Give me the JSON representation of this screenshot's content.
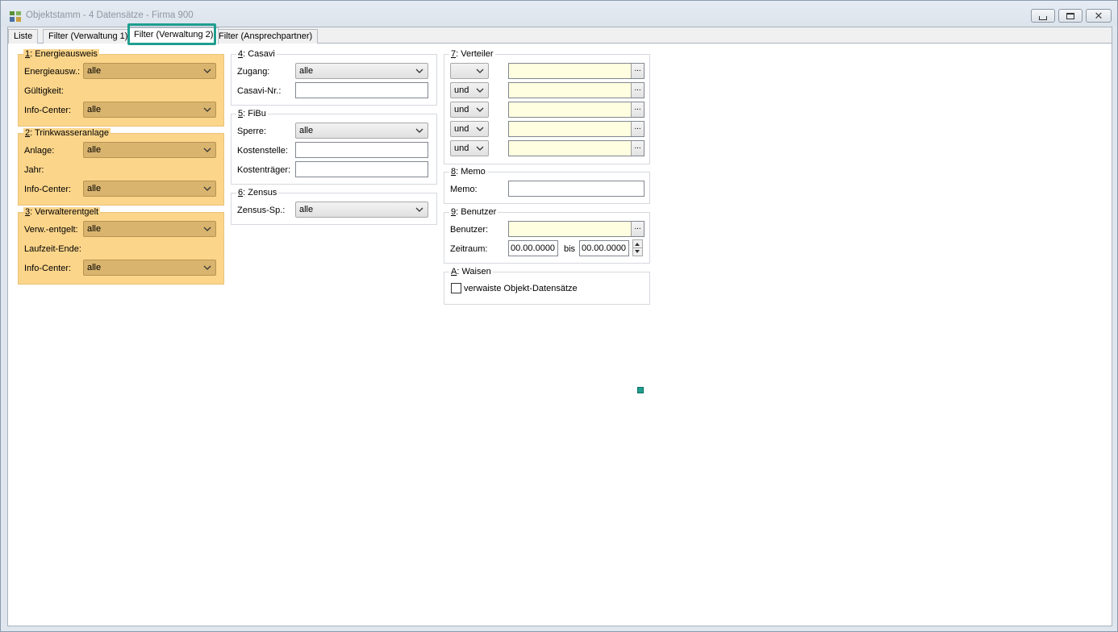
{
  "window": {
    "title": "Objektstamm - 4 Datensätze - Firma 900",
    "buttons": [
      "minimize",
      "maximize",
      "close"
    ],
    "close_glyph": "✕"
  },
  "tabs": [
    {
      "label": "Liste"
    },
    {
      "label": "Filter (Verwaltung 1)"
    },
    {
      "label": "Filter (Verwaltung 2)",
      "active": true
    },
    {
      "label": "Filter (Ansprechpartner)"
    }
  ],
  "colors": {
    "highlight_group": "#fbd58a",
    "tab_highlight": "#1f9e8f",
    "lookup_field": "#fffee0"
  },
  "g1": {
    "num": "1",
    "title": ": Energieausweis",
    "energie_label": "Energieausw.:",
    "energie_value": "alle",
    "gueltigkeit_label": "Gültigkeit:",
    "info_label": "Info-Center:",
    "info_value": "alle"
  },
  "g2": {
    "num": "2",
    "title": ": Trinkwasseranlage",
    "anlage_label": "Anlage:",
    "anlage_value": "alle",
    "jahr_label": "Jahr:",
    "info_label": "Info-Center:",
    "info_value": "alle"
  },
  "g3": {
    "num": "3",
    "title": ": Verwalterentgelt",
    "verw_label": "Verw.-entgelt:",
    "verw_value": "alle",
    "laufzeit_label": "Laufzeit-Ende:",
    "info_label": "Info-Center:",
    "info_value": "alle"
  },
  "g4": {
    "num": "4",
    "title": ": Casavi",
    "zugang_label": "Zugang:",
    "zugang_value": "alle",
    "nr_label": "Casavi-Nr.:",
    "nr_value": ""
  },
  "g5": {
    "num": "5",
    "title": ": FiBu",
    "sperre_label": "Sperre:",
    "sperre_value": "alle",
    "kostenstelle_label": "Kostenstelle:",
    "kostenstelle_value": "",
    "kostentraeger_label": "Kostenträger:",
    "kostentraeger_value": ""
  },
  "g6": {
    "num": "6",
    "title": ": Zensus",
    "zensus_label": "Zensus-Sp.:",
    "zensus_value": "alle"
  },
  "g7": {
    "num": "7",
    "title": ": Verteiler",
    "rows": [
      {
        "op": "",
        "value": ""
      },
      {
        "op": "und",
        "value": ""
      },
      {
        "op": "und",
        "value": ""
      },
      {
        "op": "und",
        "value": ""
      },
      {
        "op": "und",
        "value": ""
      }
    ],
    "dots": "..."
  },
  "g8": {
    "num": "8",
    "title": ": Memo",
    "memo_label": "Memo:",
    "memo_value": ""
  },
  "g9": {
    "num": "9",
    "title": ": Benutzer",
    "benutzer_label": "Benutzer:",
    "benutzer_value": "",
    "zeitraum_label": "Zeitraum:",
    "from": "00.00.0000",
    "bis_label": "bis",
    "to": "00.00.0000"
  },
  "gA": {
    "num": "A",
    "title": ": Waisen",
    "checkbox_label": "verwaiste Objekt-Datensätze",
    "checked": false
  }
}
